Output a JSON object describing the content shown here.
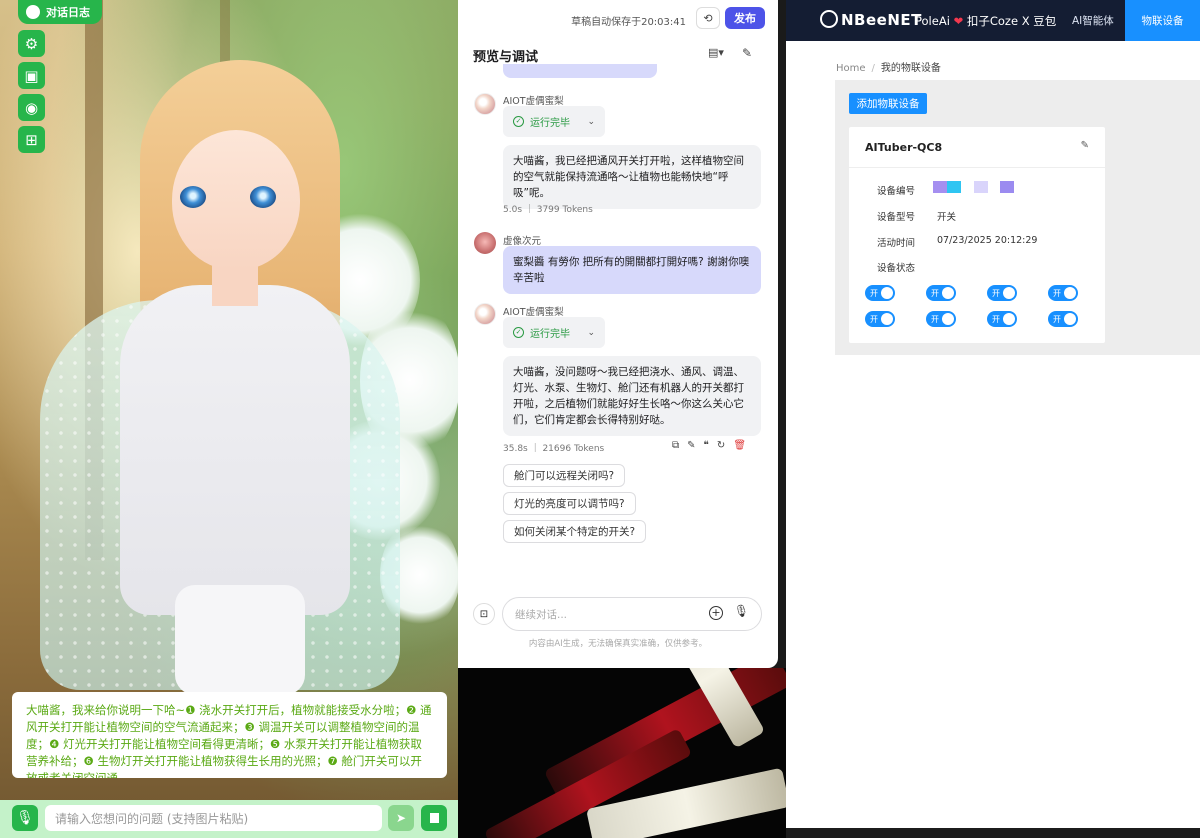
{
  "avatar_pane": {
    "chat_log_label": "对话日志",
    "side_buttons": [
      {
        "name": "settings",
        "icon": "gear-icon",
        "glyph": "⚙"
      },
      {
        "name": "background",
        "icon": "image-icon",
        "glyph": "▣"
      },
      {
        "name": "camera",
        "icon": "camera-icon",
        "glyph": "◉"
      },
      {
        "name": "add-image",
        "icon": "add-image-icon",
        "glyph": "⊞"
      }
    ],
    "speech_text": "大喵酱，我来给你说明一下哈~❶ 浇水开关打开后，植物就能接受水分啦；❷ 通风开关打开能让植物空间的空气流通起来；❸ 调温开关可以调整植物空间的温度；❹ 灯光开关打开能让植物空间看得更清晰；❺ 水泵开关打开能让植物获取营养补给；❻ 生物灯开关打开能让植物获得生长用的光照；❼ 舱门开关可以开放或者关闭空间通...",
    "input_placeholder": "请输入您想问的问题 (支持图片粘贴)",
    "accent_color": "#27b54b"
  },
  "debug_panel": {
    "autosave": "草稿自动保存于20:03:41",
    "publish_label": "发布",
    "title": "预览与调试",
    "messages": [
      {
        "sender": "AIOT虚偶蜜梨",
        "status": "运行完毕",
        "text": "大喵酱，我已经把通风开关打开啦，这样植物空间的空气就能保持流通咯～让植物也能畅快地“呼吸”呢。",
        "meta": "5.0s ｜ 3799 Tokens"
      },
      {
        "sender": "虚像次元",
        "text": "蜜梨醬 有勞你 把所有的開關都打開好嗎? 謝謝你噢 辛苦啦"
      },
      {
        "sender": "AIOT虚偶蜜梨",
        "status": "运行完毕",
        "text": "大喵酱，没问题呀～我已经把浇水、通风、调温、灯光、水泵、生物灯、舱门还有机器人的开关都打开啦，之后植物们就能好好生长咯～你这么关心它们，它们肯定都会长得特别好哒。",
        "meta": "35.8s ｜ 21696 Tokens"
      }
    ],
    "suggestions": [
      "舱门可以远程关闭吗?",
      "灯光的亮度可以调节吗?",
      "如何关闭某个特定的开关?"
    ],
    "input_placeholder": "继续对话...",
    "disclaimer": "内容由AI生成，无法确保真实准确，仅供参考。",
    "accent_color": "#4d53e8"
  },
  "iot_app": {
    "logo": "NBeeNET",
    "brand": {
      "left": "PoleAi",
      "heart": "❤",
      "right": "扣子Coze X 豆包"
    },
    "nav": {
      "ai_agent": "AI智能体",
      "iot_devices": "物联设备"
    },
    "breadcrumb": {
      "home": "Home",
      "current": "我的物联设备"
    },
    "add_device_label": "添加物联设备",
    "device": {
      "name": "AITuber-QC8",
      "labels": {
        "id": "设备编号",
        "model": "设备型号",
        "active": "活动时间",
        "status": "设备状态"
      },
      "model": "开关",
      "active_time": "07/23/2025 20:12:29",
      "id_swatches": [
        "#a58ff0",
        "#2fc5f2",
        "#d9d4fb",
        "#9b8bf0"
      ],
      "switches": [
        {
          "label": "开",
          "on": true
        },
        {
          "label": "开",
          "on": true
        },
        {
          "label": "开",
          "on": true
        },
        {
          "label": "开",
          "on": true
        },
        {
          "label": "开",
          "on": true
        },
        {
          "label": "开",
          "on": true
        },
        {
          "label": "开",
          "on": true
        },
        {
          "label": "开",
          "on": true
        }
      ]
    },
    "accent_color": "#1890ff",
    "nav_color": "#141d33"
  }
}
